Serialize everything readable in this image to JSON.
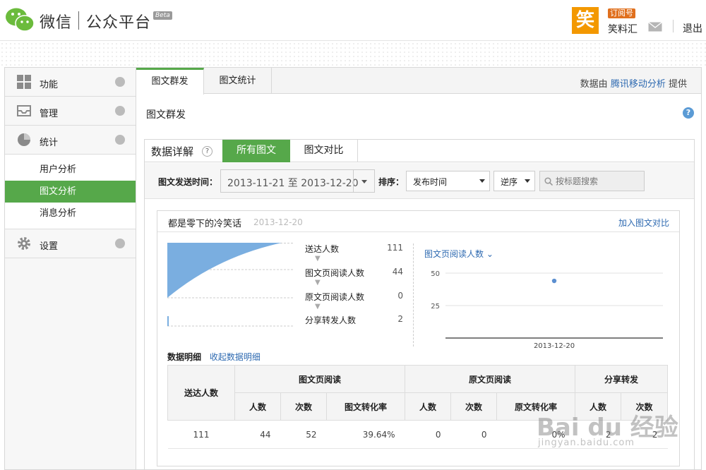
{
  "header": {
    "brand": "微信",
    "brand_sub": "公众平台",
    "beta": "Beta",
    "avatar_char": "笑",
    "account_type": "订阅号",
    "account_name": "笑料汇",
    "logout": "退出"
  },
  "sidebar": {
    "items": [
      {
        "label": "功能",
        "icon": "grid-icon"
      },
      {
        "label": "管理",
        "icon": "inbox-icon"
      },
      {
        "label": "统计",
        "icon": "pie-chart-icon"
      },
      {
        "label": "设置",
        "icon": "gear-icon"
      }
    ],
    "stats_sub": [
      "用户分析",
      "图文分析",
      "消息分析"
    ],
    "active_sub": "图文分析"
  },
  "main": {
    "tabs": [
      "图文群发",
      "图文统计"
    ],
    "provider_prefix": "数据由",
    "provider_link": "腾讯移动分析",
    "provider_suffix": "提供",
    "page_title": "图文群发",
    "panel": {
      "title": "数据详解",
      "tabs": [
        "所有图文",
        "图文对比"
      ],
      "filter": {
        "time_label": "图文发送时间：",
        "date_range": "2013-11-21 至 2013-12-20",
        "sort_label": "排序：",
        "sort_by": "发布时间",
        "order": "逆序",
        "search_placeholder": "按标题搜索"
      }
    },
    "card": {
      "title": "都是零下的冷笑话",
      "date": "2013-12-20",
      "add_compare": "加入图文对比",
      "funnel": [
        {
          "label": "送达人数",
          "value": "111"
        },
        {
          "label": "图文页阅读人数",
          "value": "44"
        },
        {
          "label": "原文页阅读人数",
          "value": "0"
        },
        {
          "label": "分享转发人数",
          "value": "2"
        }
      ],
      "chart_selector": "图文页阅读人数",
      "detail_title": "数据明细",
      "detail_toggle": "收起数据明细",
      "table": {
        "group_headers": [
          "送达人数",
          "图文页阅读",
          "原文页阅读",
          "分享转发"
        ],
        "sub_headers": [
          "人数",
          "次数",
          "图文转化率",
          "人数",
          "次数",
          "原文转化率",
          "人数",
          "次数"
        ],
        "row": [
          "111",
          "44",
          "52",
          "39.64%",
          "0",
          "0",
          "0%",
          "2",
          "2"
        ]
      }
    }
  },
  "chart_data": {
    "type": "scatter",
    "x": [
      "2013-12-20"
    ],
    "values": [
      44
    ],
    "ylim": [
      0,
      50
    ],
    "yticks": [
      25,
      50
    ],
    "xlabel": "",
    "ylabel": "",
    "grid": true
  },
  "watermark": {
    "line1": "Bai du 经验",
    "line2": "jingyan.baidu.com"
  }
}
